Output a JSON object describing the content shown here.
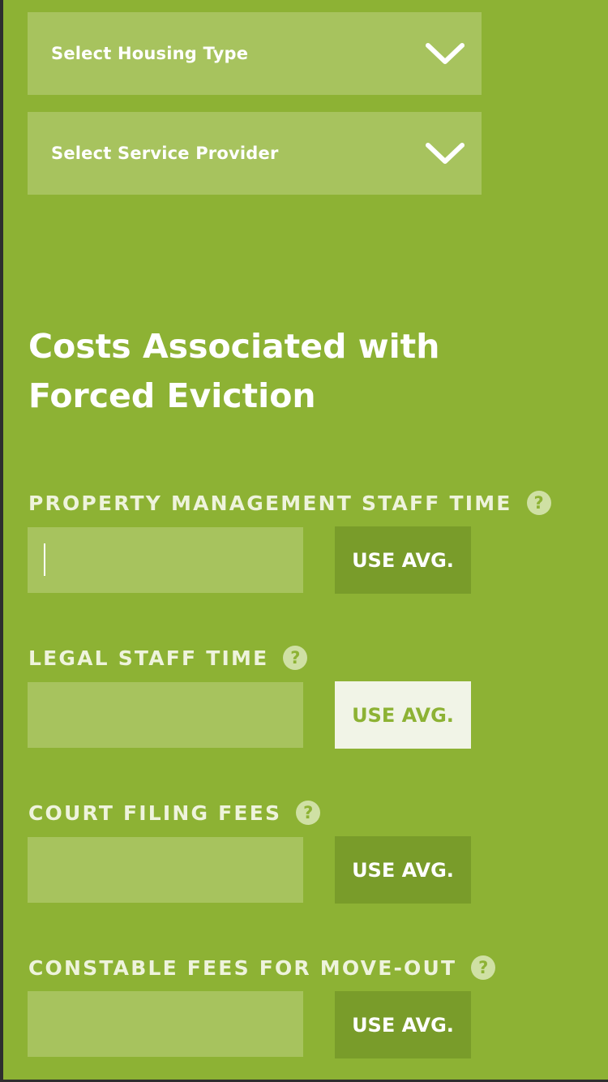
{
  "selects": {
    "housing_type": {
      "label": "Select Housing Type",
      "icon": "chevron-down-icon"
    },
    "service_provider": {
      "label": "Select Service Provider",
      "icon": "chevron-down-icon"
    }
  },
  "section": {
    "title": "Costs Associated with Forced Eviction"
  },
  "fields": [
    {
      "label": "PROPERTY MANAGEMENT STAFF TIME",
      "value": "",
      "button": "USE AVG.",
      "help": "?"
    },
    {
      "label": "LEGAL STAFF TIME",
      "value": "",
      "button": "USE AVG.",
      "help": "?"
    },
    {
      "label": "COURT FILING FEES",
      "value": "",
      "button": "USE AVG.",
      "help": "?"
    },
    {
      "label": "CONSTABLE FEES FOR MOVE-OUT",
      "value": "",
      "button": "USE AVG.",
      "help": "?"
    }
  ],
  "colors": {
    "background": "#8db234",
    "field_bg": "#a7c35e",
    "button_bg": "#799c2a",
    "button_active_bg": "#f1f4e7"
  }
}
